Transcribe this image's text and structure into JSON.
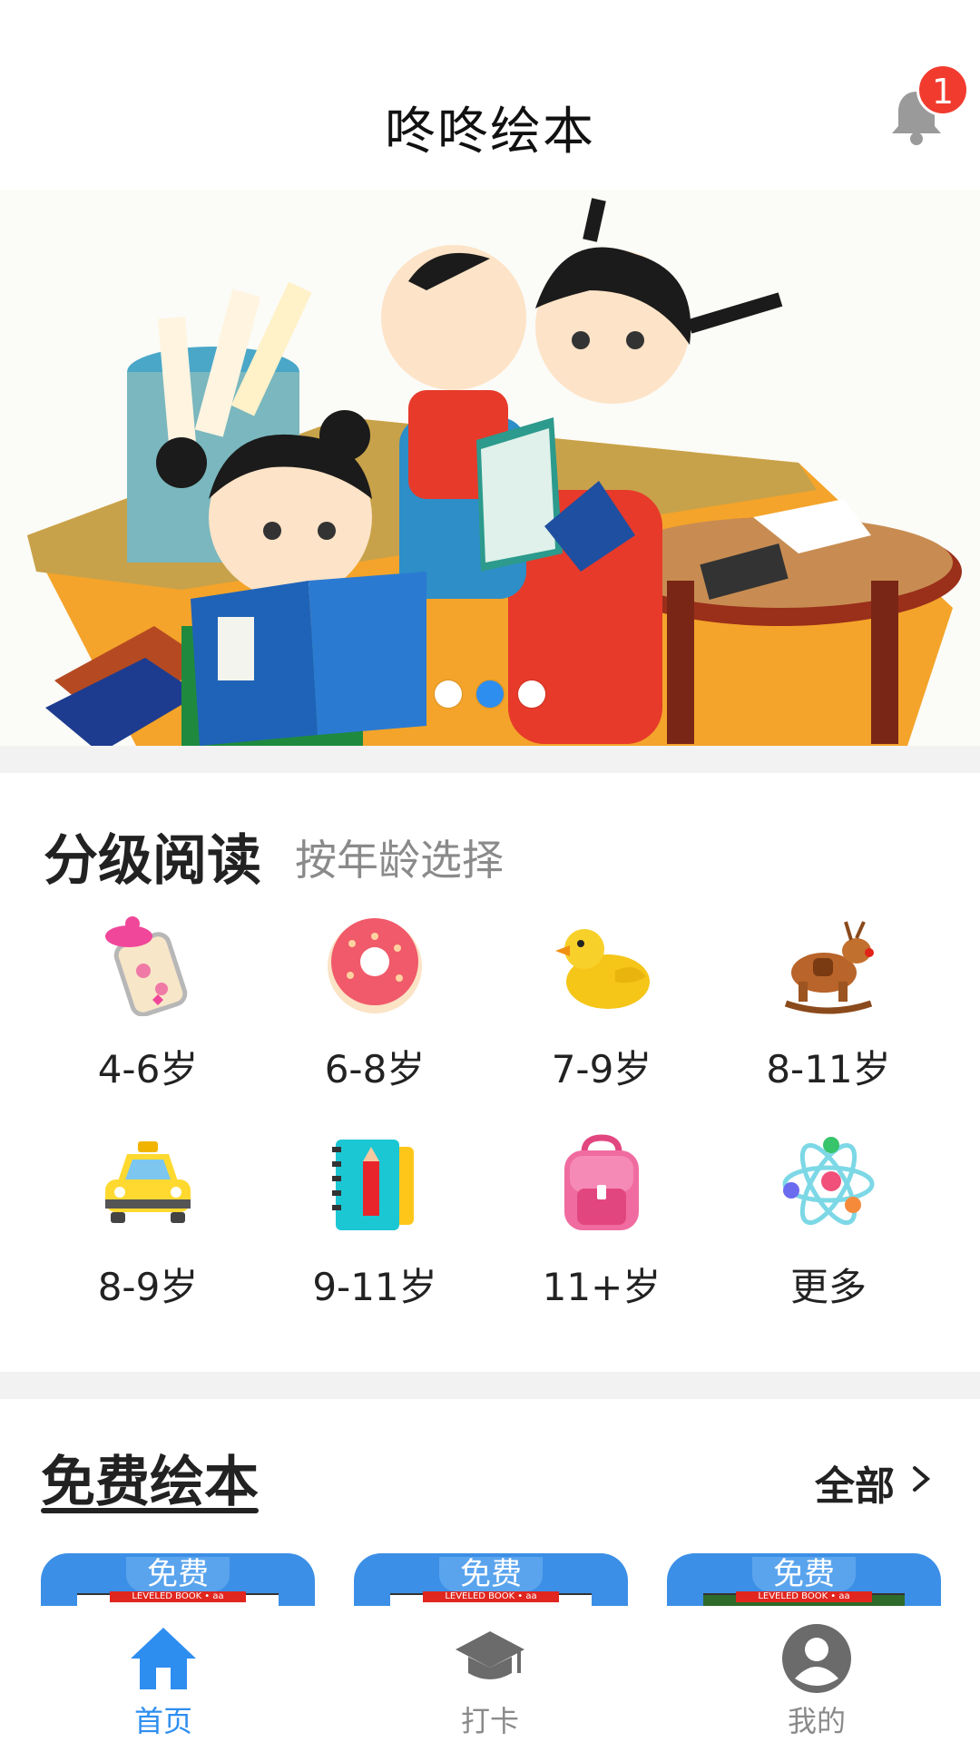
{
  "header": {
    "title": "咚咚绘本",
    "notification_count": "1"
  },
  "banner": {
    "slides": 3,
    "active_index": 1
  },
  "graded_reading": {
    "title": "分级阅读",
    "subtitle": "按年龄选择",
    "items": [
      {
        "label": "4-6岁",
        "icon": "baby-bottle-icon"
      },
      {
        "label": "6-8岁",
        "icon": "donut-icon"
      },
      {
        "label": "7-9岁",
        "icon": "duck-icon"
      },
      {
        "label": "8-11岁",
        "icon": "rocking-reindeer-icon"
      },
      {
        "label": "8-9岁",
        "icon": "taxi-icon"
      },
      {
        "label": "9-11岁",
        "icon": "notebook-icon"
      },
      {
        "label": "11+岁",
        "icon": "backpack-icon"
      },
      {
        "label": "更多",
        "icon": "atom-icon"
      }
    ]
  },
  "free_books": {
    "title": "免费绘本",
    "all_label": "全部",
    "books": [
      {
        "tag": "免费",
        "banner": "LEVELED BOOK • aa"
      },
      {
        "tag": "免费",
        "banner": "LEVELED BOOK • aa"
      },
      {
        "tag": "免费",
        "banner": "LEVELED BOOK • aa"
      }
    ]
  },
  "tabbar": {
    "tabs": [
      {
        "label": "首页",
        "icon": "home-icon",
        "active": true
      },
      {
        "label": "打卡",
        "icon": "graduation-cap-icon",
        "active": false
      },
      {
        "label": "我的",
        "icon": "user-icon",
        "active": false
      }
    ]
  },
  "colors": {
    "accent": "#2e8ef0",
    "badge": "#f23b2f",
    "inactive": "#8a8a8a"
  }
}
